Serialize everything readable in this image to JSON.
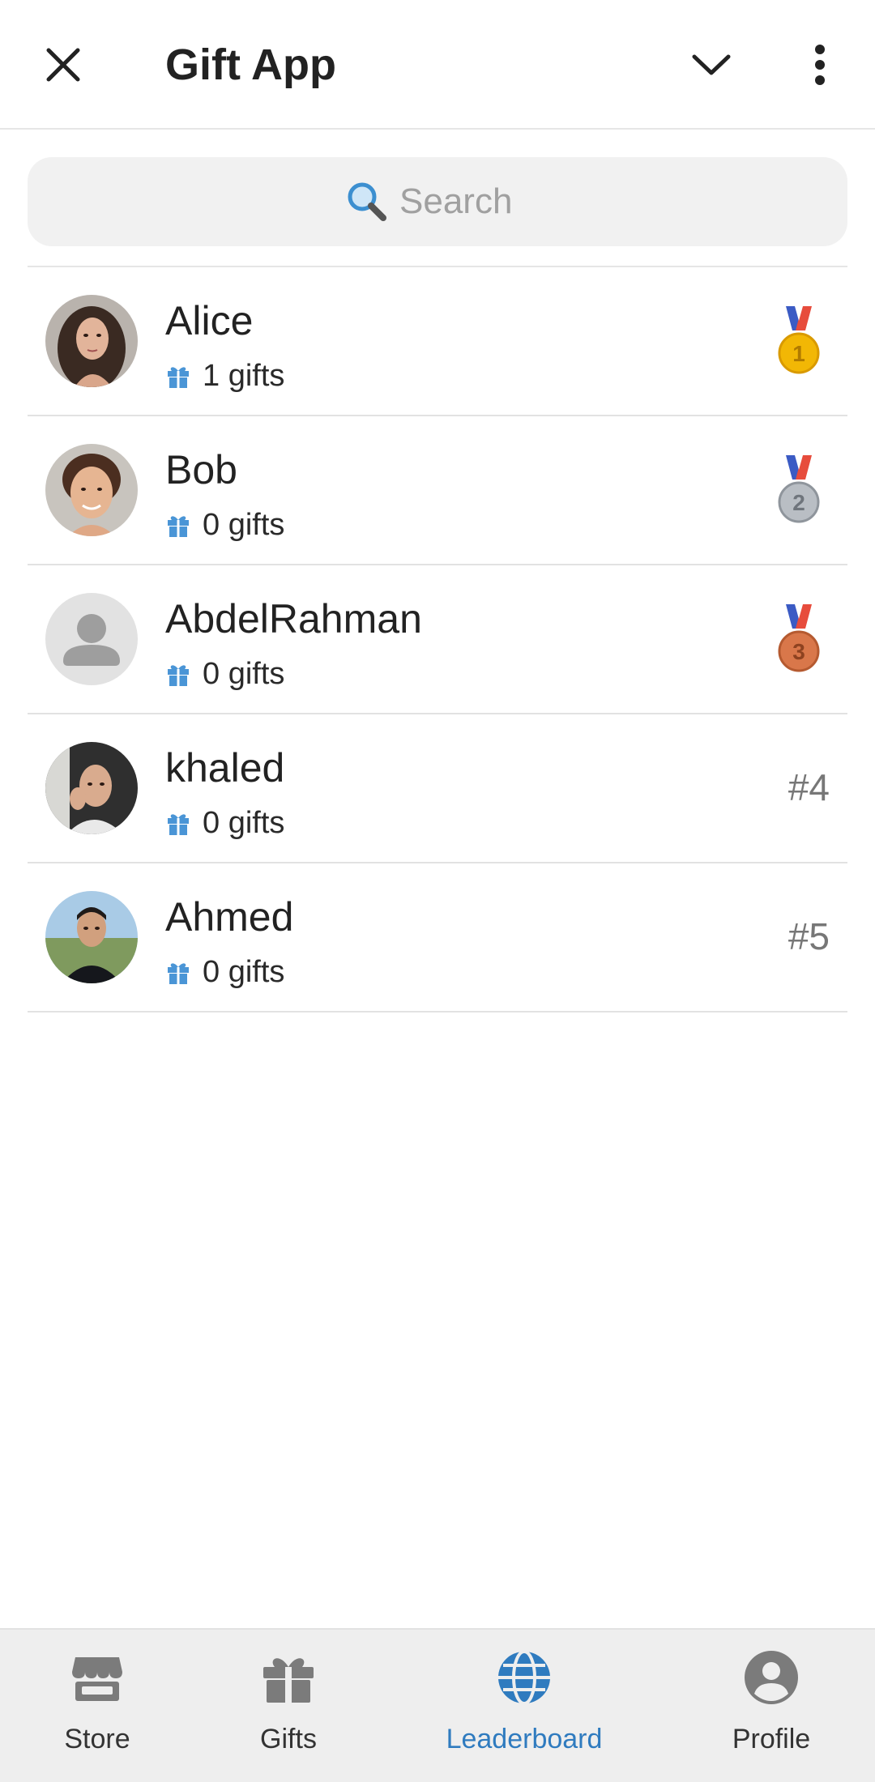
{
  "header": {
    "title": "Gift App"
  },
  "search": {
    "placeholder": "Search"
  },
  "colors": {
    "accent": "#2f7bbf",
    "gift_icon": "#4a95d6",
    "gold": "#f2b705",
    "silver": "#a9aeb4",
    "bronze": "#cd6e3e"
  },
  "leaderboard": [
    {
      "name": "Alice",
      "gifts": "1 gifts",
      "rank": "1",
      "rank_type": "gold-medal-icon"
    },
    {
      "name": "Bob",
      "gifts": "0 gifts",
      "rank": "2",
      "rank_type": "silver-medal-icon"
    },
    {
      "name": "AbdelRahman",
      "gifts": "0 gifts",
      "rank": "3",
      "rank_type": "bronze-medal-icon"
    },
    {
      "name": "khaled",
      "gifts": "0 gifts",
      "rank": "#4",
      "rank_type": "text"
    },
    {
      "name": "Ahmed",
      "gifts": "0 gifts",
      "rank": "#5",
      "rank_type": "text"
    }
  ],
  "nav": {
    "items": [
      {
        "label": "Store",
        "icon": "store-icon",
        "active": false
      },
      {
        "label": "Gifts",
        "icon": "gift-icon",
        "active": false
      },
      {
        "label": "Leaderboard",
        "icon": "globe-icon",
        "active": true
      },
      {
        "label": "Profile",
        "icon": "profile-icon",
        "active": false
      }
    ]
  }
}
